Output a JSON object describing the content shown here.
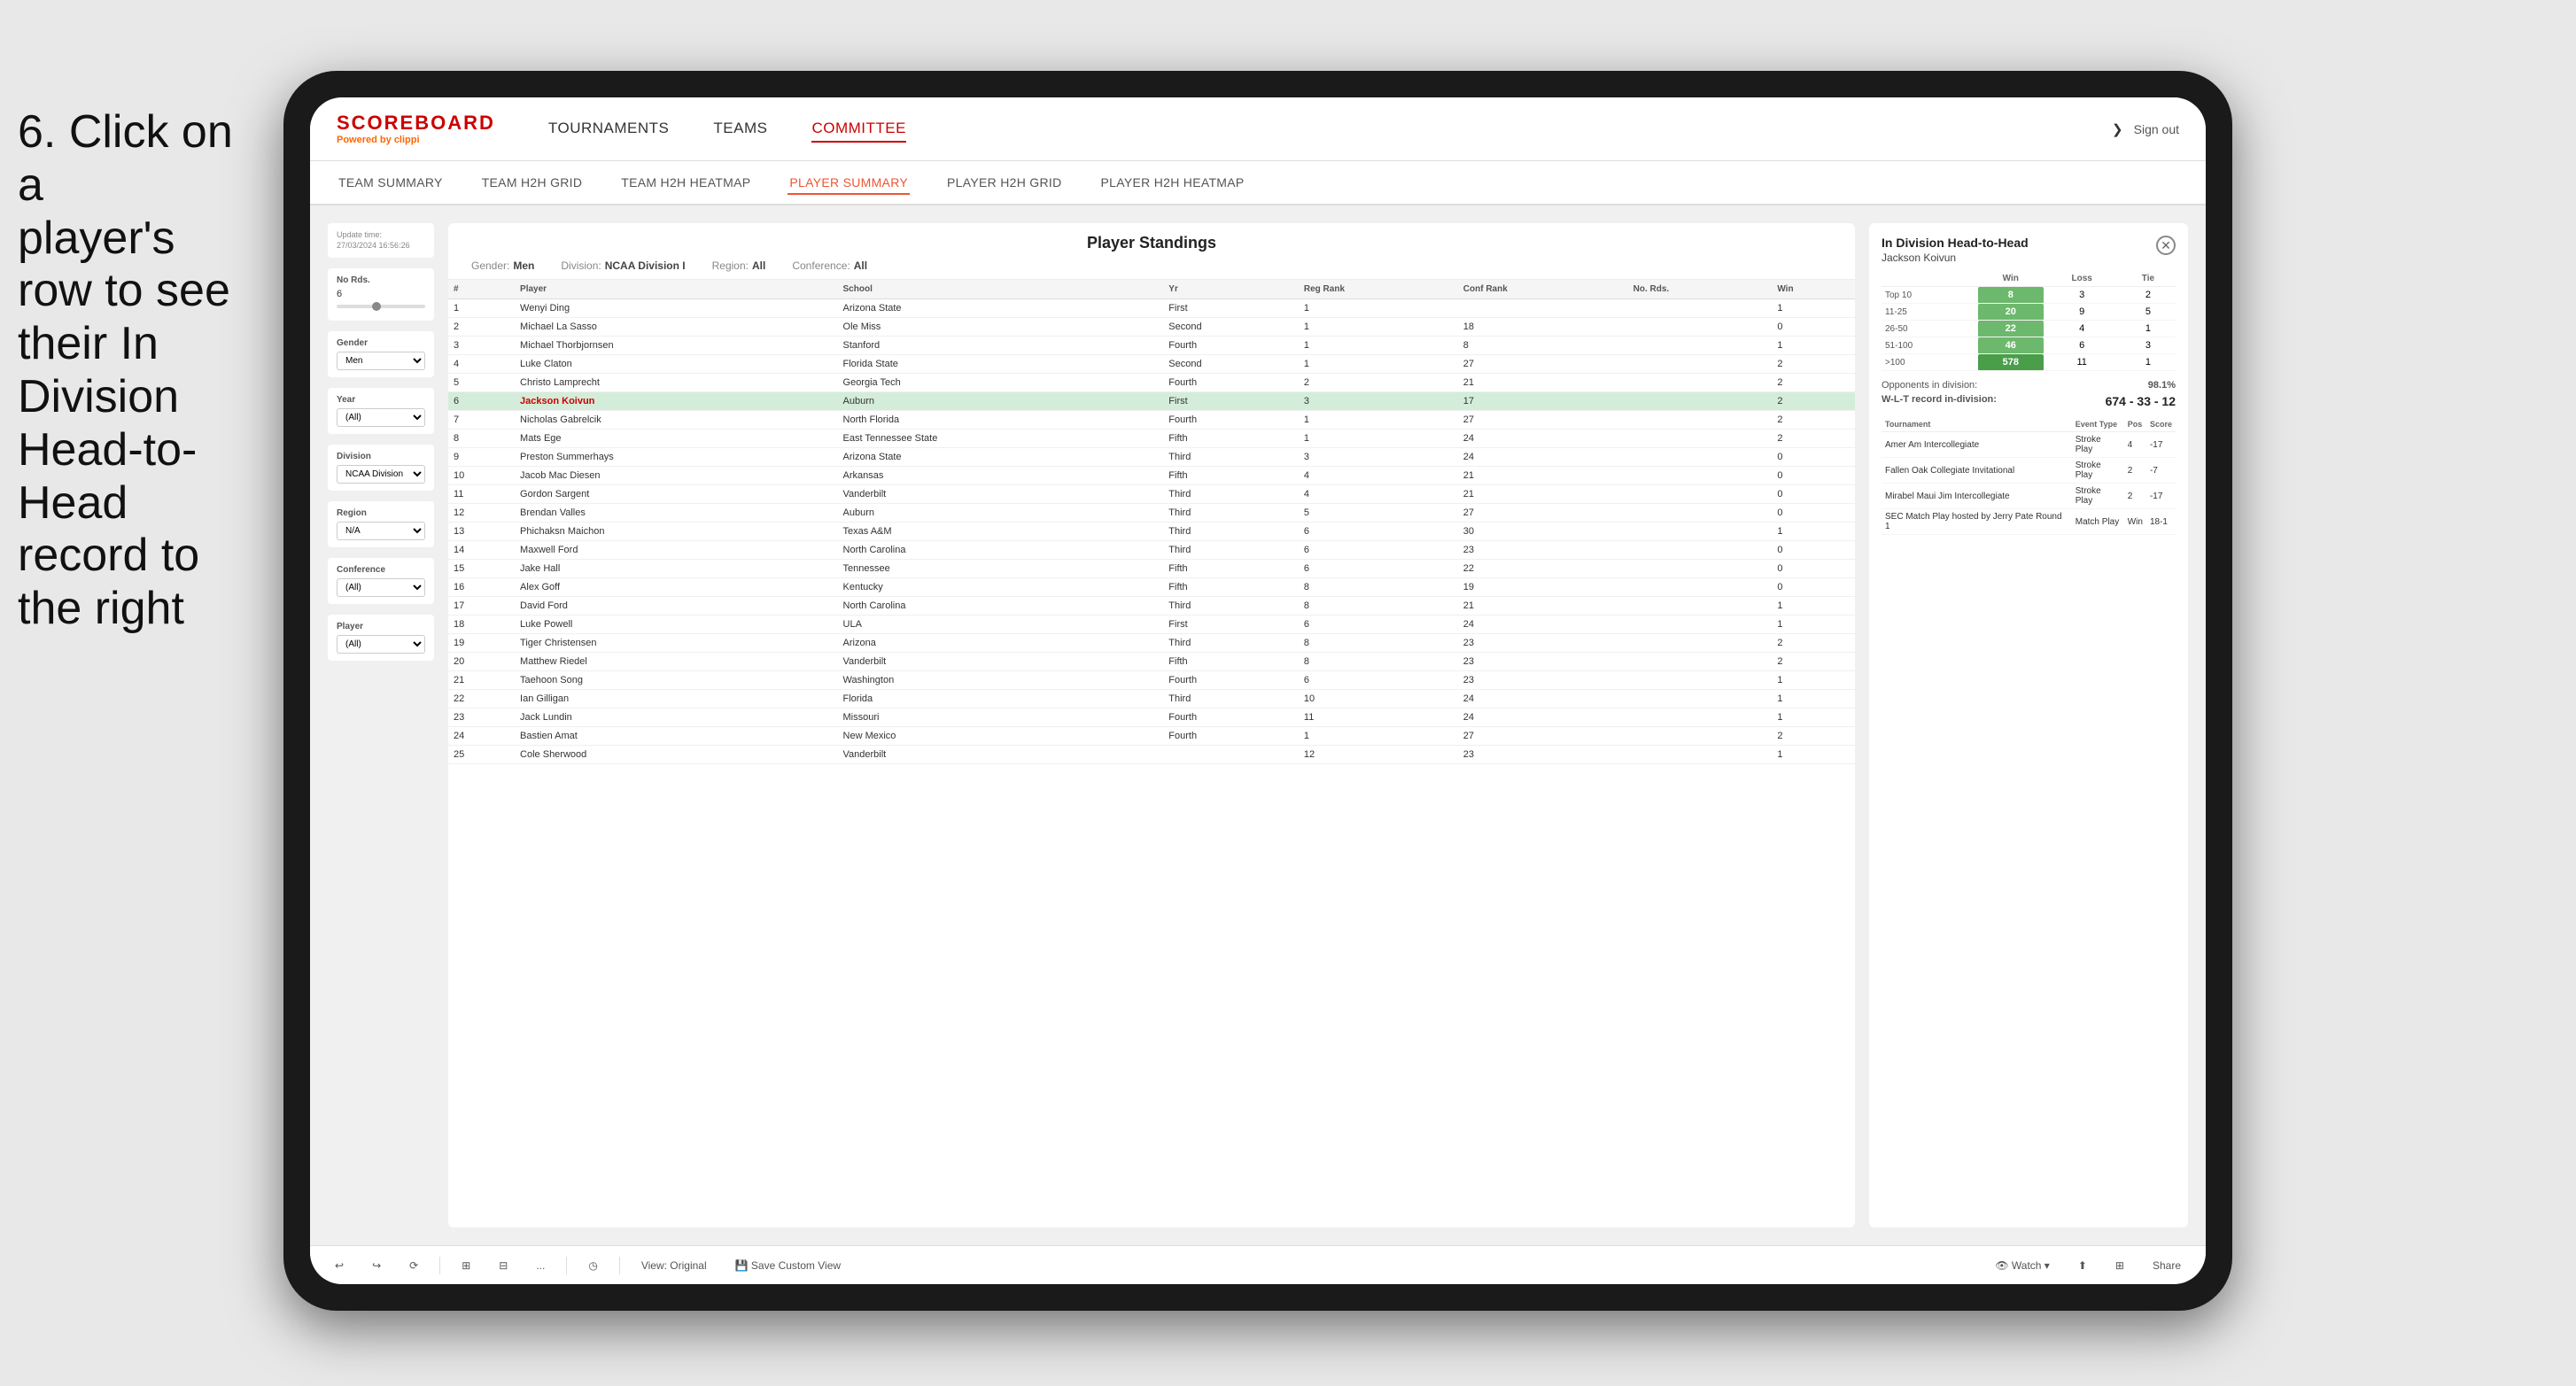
{
  "instruction": {
    "line1": "6. Click on a",
    "line2": "player's row to see",
    "line3": "their In Division",
    "line4": "Head-to-Head",
    "line5": "record to the right"
  },
  "nav": {
    "logo": "SCOREBOARD",
    "logo_sub": "Powered by",
    "logo_brand": "clippi",
    "links": [
      "TOURNAMENTS",
      "TEAMS",
      "COMMITTEE"
    ],
    "sign_out": "Sign out",
    "active_link": "COMMITTEE"
  },
  "sub_nav": {
    "links": [
      "TEAM SUMMARY",
      "TEAM H2H GRID",
      "TEAM H2H HEATMAP",
      "PLAYER SUMMARY",
      "PLAYER H2H GRID",
      "PLAYER H2H HEATMAP"
    ],
    "active": "PLAYER SUMMARY"
  },
  "filters": {
    "update_time_label": "Update time:",
    "update_time": "27/03/2024 16:56:26",
    "no_rds_label": "No Rds.",
    "no_rds_value": "6",
    "gender_label": "Gender",
    "gender_value": "Men",
    "year_label": "Year",
    "year_value": "(All)",
    "division_label": "Division",
    "division_value": "NCAA Division I",
    "region_label": "Region",
    "region_value": "N/A",
    "conference_label": "Conference",
    "conference_value": "(All)",
    "player_label": "Player",
    "player_value": "(All)"
  },
  "standings": {
    "title": "Player Standings",
    "gender_label": "Gender:",
    "gender_value": "Men",
    "division_label": "Division:",
    "division_value": "NCAA Division I",
    "region_label": "Region:",
    "region_value": "All",
    "conference_label": "Conference:",
    "conference_value": "All",
    "columns": [
      "#",
      "Player",
      "School",
      "Yr",
      "Reg Rank",
      "Conf Rank",
      "No. Rds.",
      "Win"
    ],
    "rows": [
      {
        "num": 1,
        "player": "Wenyi Ding",
        "school": "Arizona State",
        "yr": "First",
        "reg": 1,
        "conf": "",
        "rds": "",
        "win": 1
      },
      {
        "num": 2,
        "player": "Michael La Sasso",
        "school": "Ole Miss",
        "yr": "Second",
        "reg": 1,
        "conf": 18,
        "rds": "",
        "win": 0
      },
      {
        "num": 3,
        "player": "Michael Thorbjornsen",
        "school": "Stanford",
        "yr": "Fourth",
        "reg": 1,
        "conf": 8,
        "rds": "",
        "win": 1
      },
      {
        "num": 4,
        "player": "Luke Claton",
        "school": "Florida State",
        "yr": "Second",
        "reg": 1,
        "conf": 27,
        "rds": "",
        "win": 2
      },
      {
        "num": 5,
        "player": "Christo Lamprecht",
        "school": "Georgia Tech",
        "yr": "Fourth",
        "reg": 2,
        "conf": 21,
        "rds": "",
        "win": 2
      },
      {
        "num": 6,
        "player": "Jackson Koivun",
        "school": "Auburn",
        "yr": "First",
        "reg": 3,
        "conf": 17,
        "rds": "",
        "win": 2,
        "highlighted": true
      },
      {
        "num": 7,
        "player": "Nicholas Gabrelcik",
        "school": "North Florida",
        "yr": "Fourth",
        "reg": 1,
        "conf": 27,
        "rds": "",
        "win": 2
      },
      {
        "num": 8,
        "player": "Mats Ege",
        "school": "East Tennessee State",
        "yr": "Fifth",
        "reg": 1,
        "conf": 24,
        "rds": "",
        "win": 2
      },
      {
        "num": 9,
        "player": "Preston Summerhays",
        "school": "Arizona State",
        "yr": "Third",
        "reg": 3,
        "conf": 24,
        "rds": "",
        "win": 0
      },
      {
        "num": 10,
        "player": "Jacob Mac Diesen",
        "school": "Arkansas",
        "yr": "Fifth",
        "reg": 4,
        "conf": 21,
        "rds": "",
        "win": 0
      },
      {
        "num": 11,
        "player": "Gordon Sargent",
        "school": "Vanderbilt",
        "yr": "Third",
        "reg": 4,
        "conf": 21,
        "rds": "",
        "win": 0
      },
      {
        "num": 12,
        "player": "Brendan Valles",
        "school": "Auburn",
        "yr": "Third",
        "reg": 5,
        "conf": 27,
        "rds": "",
        "win": 0
      },
      {
        "num": 13,
        "player": "Phichaksn Maichon",
        "school": "Texas A&M",
        "yr": "Third",
        "reg": 6,
        "conf": 30,
        "rds": "",
        "win": 1
      },
      {
        "num": 14,
        "player": "Maxwell Ford",
        "school": "North Carolina",
        "yr": "Third",
        "reg": 6,
        "conf": 23,
        "rds": "",
        "win": 0
      },
      {
        "num": 15,
        "player": "Jake Hall",
        "school": "Tennessee",
        "yr": "Fifth",
        "reg": 6,
        "conf": 22,
        "rds": "",
        "win": 0
      },
      {
        "num": 16,
        "player": "Alex Goff",
        "school": "Kentucky",
        "yr": "Fifth",
        "reg": 8,
        "conf": 19,
        "rds": "",
        "win": 0
      },
      {
        "num": 17,
        "player": "David Ford",
        "school": "North Carolina",
        "yr": "Third",
        "reg": 8,
        "conf": 21,
        "rds": "",
        "win": 1
      },
      {
        "num": 18,
        "player": "Luke Powell",
        "school": "ULA",
        "yr": "First",
        "reg": 6,
        "conf": 24,
        "rds": "",
        "win": 1
      },
      {
        "num": 19,
        "player": "Tiger Christensen",
        "school": "Arizona",
        "yr": "Third",
        "reg": 8,
        "conf": 23,
        "rds": "",
        "win": 2
      },
      {
        "num": 20,
        "player": "Matthew Riedel",
        "school": "Vanderbilt",
        "yr": "Fifth",
        "reg": 8,
        "conf": 23,
        "rds": "",
        "win": 2
      },
      {
        "num": 21,
        "player": "Taehoon Song",
        "school": "Washington",
        "yr": "Fourth",
        "reg": 6,
        "conf": 23,
        "rds": "",
        "win": 1
      },
      {
        "num": 22,
        "player": "Ian Gilligan",
        "school": "Florida",
        "yr": "Third",
        "reg": 10,
        "conf": 24,
        "rds": "",
        "win": 1
      },
      {
        "num": 23,
        "player": "Jack Lundin",
        "school": "Missouri",
        "yr": "Fourth",
        "reg": 11,
        "conf": 24,
        "rds": "",
        "win": 1
      },
      {
        "num": 24,
        "player": "Bastien Amat",
        "school": "New Mexico",
        "yr": "Fourth",
        "reg": 1,
        "conf": 27,
        "rds": "",
        "win": 2
      },
      {
        "num": 25,
        "player": "Cole Sherwood",
        "school": "Vanderbilt",
        "yr": "",
        "reg": 12,
        "conf": 23,
        "rds": "",
        "win": 1
      }
    ]
  },
  "h2h": {
    "title": "In Division Head-to-Head",
    "player_name": "Jackson Koivun",
    "columns": [
      "Win",
      "Loss",
      "Tie"
    ],
    "rows": [
      {
        "label": "Top 10",
        "win": 8,
        "loss": 3,
        "tie": 2,
        "win_big": false
      },
      {
        "label": "11-25",
        "win": 20,
        "loss": 9,
        "tie": 5,
        "win_big": false
      },
      {
        "label": "26-50",
        "win": 22,
        "loss": 4,
        "tie": 1,
        "win_big": false
      },
      {
        "label": "51-100",
        "win": 46,
        "loss": 6,
        "tie": 3,
        "win_big": false
      },
      {
        "label": ">100",
        "win": 578,
        "loss": 11,
        "tie": 1,
        "win_big": true
      }
    ],
    "opponents_label": "Opponents in division:",
    "opponents_value": "98.1%",
    "wlt_label": "W-L-T record in-division:",
    "wlt_value": "674 - 33 - 12",
    "tournament_columns": [
      "Tournament",
      "Event Type",
      "Pos",
      "Score"
    ],
    "tournament_rows": [
      {
        "tournament": "Amer Am Intercollegiate",
        "type": "Stroke Play",
        "pos": 4,
        "score": -17
      },
      {
        "tournament": "Fallen Oak Collegiate Invitational",
        "type": "Stroke Play",
        "pos": 2,
        "score": -7
      },
      {
        "tournament": "Mirabel Maui Jim Intercollegiate",
        "type": "Stroke Play",
        "pos": 2,
        "score": -17
      },
      {
        "tournament": "SEC Match Play hosted by Jerry Pate Round 1",
        "type": "Match Play",
        "pos": "Win",
        "score": "18-1"
      }
    ]
  },
  "toolbar": {
    "buttons": [
      "↩",
      "↪",
      "⟳",
      "⊞",
      "⊟",
      "...",
      "◷",
      "View: Original",
      "Save Custom View",
      "👁 Watch ▾",
      "⬆",
      "⊞",
      "Share"
    ]
  }
}
